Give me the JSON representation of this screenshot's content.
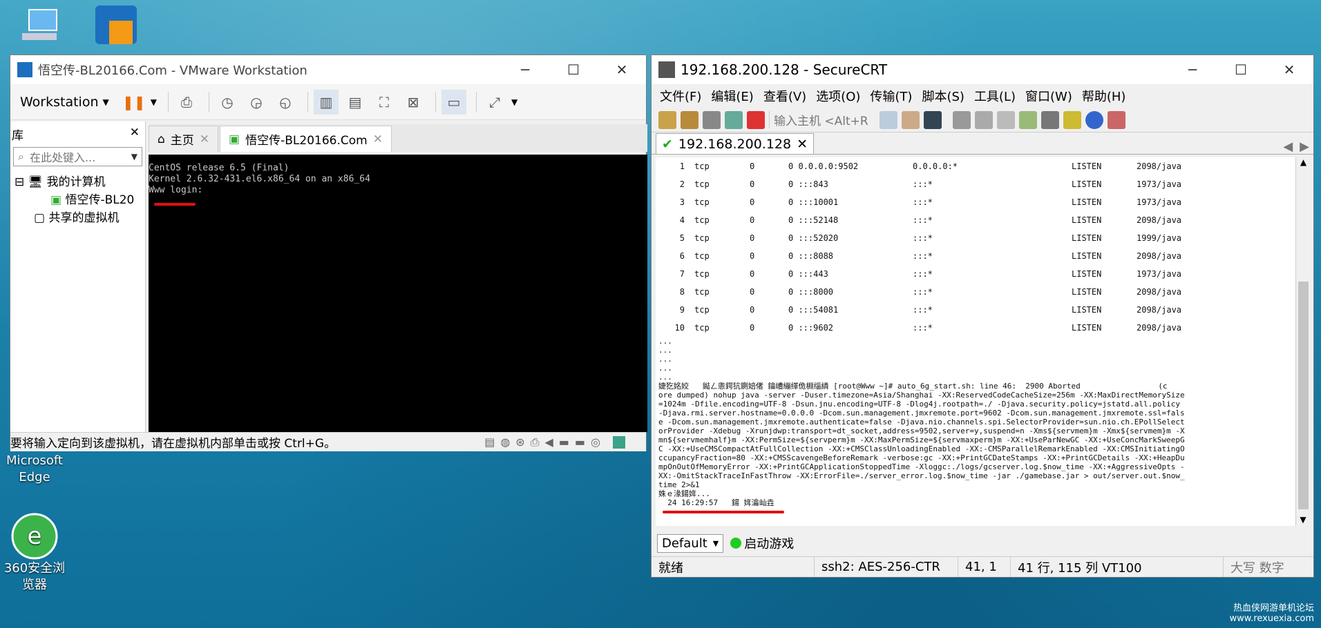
{
  "desktop": {
    "icons": [
      {
        "label": ""
      },
      {
        "label": ""
      },
      {
        "label": "Microsoft Edge"
      },
      {
        "label": "360安全浏览器"
      }
    ],
    "watermark": "热血侠网游单机论坛",
    "watermark_url": "www.rexuexia.com"
  },
  "vmware": {
    "title": "悟空传-BL20166.Com - VMware Workstation",
    "workstation_menu": "Workstation",
    "library_title": "库",
    "search_placeholder": "在此处键入...",
    "tree": {
      "my_computer": "我的计算机",
      "vm": "悟空传-BL20",
      "shared": "共享的虚拟机"
    },
    "tabs": {
      "home": "主页",
      "vm": "悟空传-BL20166.Com"
    },
    "console": [
      "CentOS release 6.5 (Final)",
      "Kernel 2.6.32-431.el6.x86_64 on an x86_64",
      "",
      "Www login:"
    ],
    "status": "要将输入定向到该虚拟机，请在虚拟机内部单击或按 Ctrl+G。"
  },
  "crt": {
    "title": "192.168.200.128 - SecureCRT",
    "menu": [
      "文件(F)",
      "编辑(E)",
      "查看(V)",
      "选项(O)",
      "传输(T)",
      "脚本(S)",
      "工具(L)",
      "窗口(W)",
      "帮助(H)"
    ],
    "host_input": "输入主机 <Alt+R",
    "tab": "192.168.200.128",
    "rows": [
      [
        "1",
        "tcp",
        "0",
        "0 0.0.0.0:9502",
        "0.0.0.0:*",
        "LISTEN",
        "2098/java"
      ],
      [
        "2",
        "tcp",
        "0",
        "0 :::843",
        ":::*",
        "LISTEN",
        "1973/java"
      ],
      [
        "3",
        "tcp",
        "0",
        "0 :::10001",
        ":::*",
        "LISTEN",
        "1973/java"
      ],
      [
        "4",
        "tcp",
        "0",
        "0 :::52148",
        ":::*",
        "LISTEN",
        "2098/java"
      ],
      [
        "5",
        "tcp",
        "0",
        "0 :::52020",
        ":::*",
        "LISTEN",
        "1999/java"
      ],
      [
        "6",
        "tcp",
        "0",
        "0 :::8088",
        ":::*",
        "LISTEN",
        "2098/java"
      ],
      [
        "7",
        "tcp",
        "0",
        "0 :::443",
        ":::*",
        "LISTEN",
        "1973/java"
      ],
      [
        "8",
        "tcp",
        "0",
        "0 :::8000",
        ":::*",
        "LISTEN",
        "2098/java"
      ],
      [
        "9",
        "tcp",
        "0",
        "0 :::54081",
        ":::*",
        "LISTEN",
        "2098/java"
      ],
      [
        "10",
        "tcp",
        "0",
        "0 :::9602",
        ":::*",
        "LISTEN",
        "2098/java"
      ]
    ],
    "log": [
      "...",
      "...",
      "...",
      "...",
      "...",
      "婕犵姳姣   鐑ㄥ悤鍔犺鍘婄偖 鑰嶆繃缂佹棩缁繗 [root@Www ~]# auto_6g_start.sh: line 46:  2900 Aborted                 (c",
      "ore dumped) nohup java -server -Duser.timezone=Asia/Shanghai -XX:ReservedCodeCacheSize=256m -XX:MaxDirectMemorySize",
      "=1024m -Dfile.encoding=UTF-8 -Dsun.jnu.encoding=UTF-8 -Dlog4j.rootpath=./ -Djava.security.policy=jstatd.all.policy",
      "-Djava.rmi.server.hostname=0.0.0.0 -Dcom.sun.management.jmxremote.port=9602 -Dcom.sun.management.jmxremote.ssl=fals",
      "e -Dcom.sun.management.jmxremote.authenticate=false -Djava.nio.channels.spi.SelectorProvider=sun.nio.ch.EPollSelect",
      "orProvider -Xdebug -Xrunjdwp:transport=dt_socket,address=9502,server=y,suspend=n -Xms${servmem}m -Xmx${servmem}m -X",
      "mn${servmemhalf}m -XX:PermSize=${servperm}m -XX:MaxPermSize=${servmaxperm}m -XX:+UseParNewGC -XX:+UseConcMarkSweepG",
      "C -XX:+UseCMSCompactAtFullCollection -XX:+CMSClassUnloadingEnabled -XX:-CMSParallelRemarkEnabled -XX:CMSInitiatingO",
      "ccupancyFraction=80 -XX:+CMSScavengeBeforeRemark -verbose:gc -XX:+PrintGCDateStamps -XX:+PrintGCDetails -XX:+HeapDu",
      "mpOnOutOfMemoryError -XX:+PrintGCApplicationStoppedTime -Xloggc:./logs/gcserver.log.$now_time -XX:+AggressiveOpts -",
      "XX:-OmitStackTraceInFastThrow -XX:ErrorFile=./server_error.log.$now_time -jar ./gamebase.jar > out/server.out.$now_",
      "time 2>&1",
      "姝ｅ湪鍚姩...",
      "  24 16:29:57   鍚 姩瀹屾垚"
    ],
    "session": "Default",
    "launch": "启动游戏",
    "status": {
      "ready": "就绪",
      "ssh": "ssh2: AES-256-CTR",
      "pos": "41,  1",
      "rows": "41 行, 115 列 VT100",
      "caps": "大写 数字"
    }
  }
}
